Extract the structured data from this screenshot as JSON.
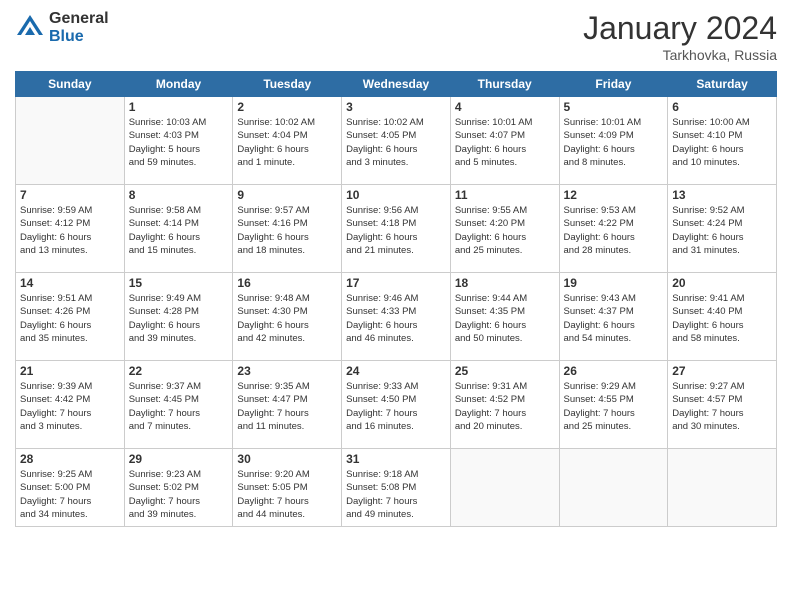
{
  "header": {
    "logo_general": "General",
    "logo_blue": "Blue",
    "month_title": "January 2024",
    "location": "Tarkhovka, Russia"
  },
  "days_of_week": [
    "Sunday",
    "Monday",
    "Tuesday",
    "Wednesday",
    "Thursday",
    "Friday",
    "Saturday"
  ],
  "weeks": [
    [
      {
        "day": "",
        "info": ""
      },
      {
        "day": "1",
        "info": "Sunrise: 10:03 AM\nSunset: 4:03 PM\nDaylight: 5 hours\nand 59 minutes."
      },
      {
        "day": "2",
        "info": "Sunrise: 10:02 AM\nSunset: 4:04 PM\nDaylight: 6 hours\nand 1 minute."
      },
      {
        "day": "3",
        "info": "Sunrise: 10:02 AM\nSunset: 4:05 PM\nDaylight: 6 hours\nand 3 minutes."
      },
      {
        "day": "4",
        "info": "Sunrise: 10:01 AM\nSunset: 4:07 PM\nDaylight: 6 hours\nand 5 minutes."
      },
      {
        "day": "5",
        "info": "Sunrise: 10:01 AM\nSunset: 4:09 PM\nDaylight: 6 hours\nand 8 minutes."
      },
      {
        "day": "6",
        "info": "Sunrise: 10:00 AM\nSunset: 4:10 PM\nDaylight: 6 hours\nand 10 minutes."
      }
    ],
    [
      {
        "day": "7",
        "info": "Sunrise: 9:59 AM\nSunset: 4:12 PM\nDaylight: 6 hours\nand 13 minutes."
      },
      {
        "day": "8",
        "info": "Sunrise: 9:58 AM\nSunset: 4:14 PM\nDaylight: 6 hours\nand 15 minutes."
      },
      {
        "day": "9",
        "info": "Sunrise: 9:57 AM\nSunset: 4:16 PM\nDaylight: 6 hours\nand 18 minutes."
      },
      {
        "day": "10",
        "info": "Sunrise: 9:56 AM\nSunset: 4:18 PM\nDaylight: 6 hours\nand 21 minutes."
      },
      {
        "day": "11",
        "info": "Sunrise: 9:55 AM\nSunset: 4:20 PM\nDaylight: 6 hours\nand 25 minutes."
      },
      {
        "day": "12",
        "info": "Sunrise: 9:53 AM\nSunset: 4:22 PM\nDaylight: 6 hours\nand 28 minutes."
      },
      {
        "day": "13",
        "info": "Sunrise: 9:52 AM\nSunset: 4:24 PM\nDaylight: 6 hours\nand 31 minutes."
      }
    ],
    [
      {
        "day": "14",
        "info": "Sunrise: 9:51 AM\nSunset: 4:26 PM\nDaylight: 6 hours\nand 35 minutes."
      },
      {
        "day": "15",
        "info": "Sunrise: 9:49 AM\nSunset: 4:28 PM\nDaylight: 6 hours\nand 39 minutes."
      },
      {
        "day": "16",
        "info": "Sunrise: 9:48 AM\nSunset: 4:30 PM\nDaylight: 6 hours\nand 42 minutes."
      },
      {
        "day": "17",
        "info": "Sunrise: 9:46 AM\nSunset: 4:33 PM\nDaylight: 6 hours\nand 46 minutes."
      },
      {
        "day": "18",
        "info": "Sunrise: 9:44 AM\nSunset: 4:35 PM\nDaylight: 6 hours\nand 50 minutes."
      },
      {
        "day": "19",
        "info": "Sunrise: 9:43 AM\nSunset: 4:37 PM\nDaylight: 6 hours\nand 54 minutes."
      },
      {
        "day": "20",
        "info": "Sunrise: 9:41 AM\nSunset: 4:40 PM\nDaylight: 6 hours\nand 58 minutes."
      }
    ],
    [
      {
        "day": "21",
        "info": "Sunrise: 9:39 AM\nSunset: 4:42 PM\nDaylight: 7 hours\nand 3 minutes."
      },
      {
        "day": "22",
        "info": "Sunrise: 9:37 AM\nSunset: 4:45 PM\nDaylight: 7 hours\nand 7 minutes."
      },
      {
        "day": "23",
        "info": "Sunrise: 9:35 AM\nSunset: 4:47 PM\nDaylight: 7 hours\nand 11 minutes."
      },
      {
        "day": "24",
        "info": "Sunrise: 9:33 AM\nSunset: 4:50 PM\nDaylight: 7 hours\nand 16 minutes."
      },
      {
        "day": "25",
        "info": "Sunrise: 9:31 AM\nSunset: 4:52 PM\nDaylight: 7 hours\nand 20 minutes."
      },
      {
        "day": "26",
        "info": "Sunrise: 9:29 AM\nSunset: 4:55 PM\nDaylight: 7 hours\nand 25 minutes."
      },
      {
        "day": "27",
        "info": "Sunrise: 9:27 AM\nSunset: 4:57 PM\nDaylight: 7 hours\nand 30 minutes."
      }
    ],
    [
      {
        "day": "28",
        "info": "Sunrise: 9:25 AM\nSunset: 5:00 PM\nDaylight: 7 hours\nand 34 minutes."
      },
      {
        "day": "29",
        "info": "Sunrise: 9:23 AM\nSunset: 5:02 PM\nDaylight: 7 hours\nand 39 minutes."
      },
      {
        "day": "30",
        "info": "Sunrise: 9:20 AM\nSunset: 5:05 PM\nDaylight: 7 hours\nand 44 minutes."
      },
      {
        "day": "31",
        "info": "Sunrise: 9:18 AM\nSunset: 5:08 PM\nDaylight: 7 hours\nand 49 minutes."
      },
      {
        "day": "",
        "info": ""
      },
      {
        "day": "",
        "info": ""
      },
      {
        "day": "",
        "info": ""
      }
    ]
  ]
}
